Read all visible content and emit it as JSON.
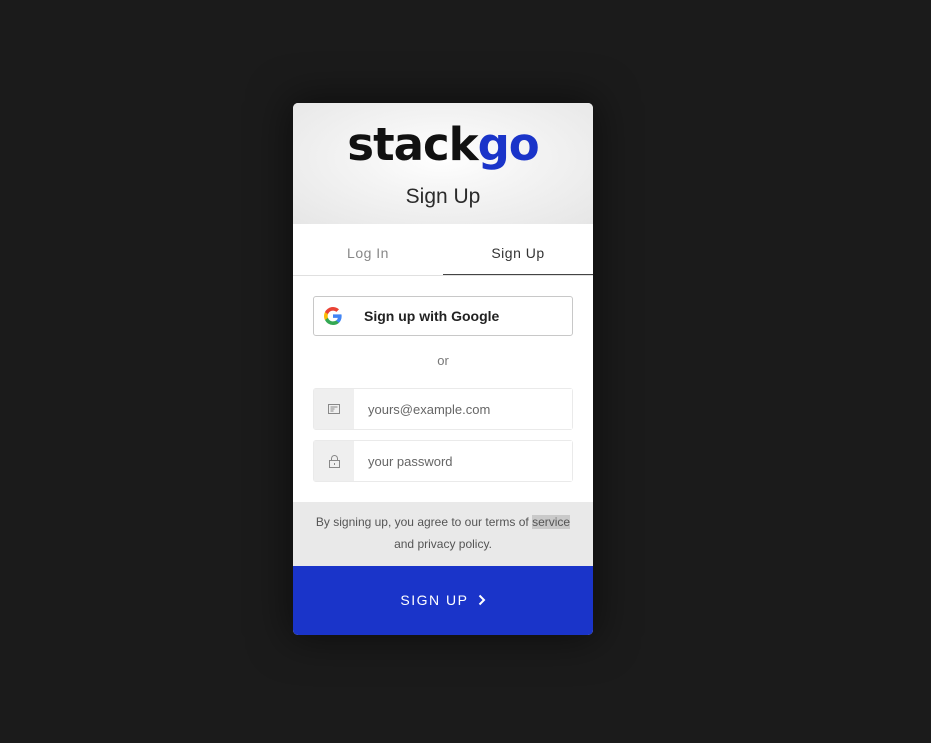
{
  "header": {
    "logo_part1": "stack",
    "logo_part2": "go",
    "title": "Sign Up"
  },
  "tabs": [
    {
      "label": "Log In",
      "active": false
    },
    {
      "label": "Sign Up",
      "active": true
    }
  ],
  "google_button": {
    "label": "Sign up with Google",
    "icon": "google-icon"
  },
  "divider": "or",
  "email": {
    "value": "",
    "placeholder": "yours@example.com",
    "icon": "envelope-icon"
  },
  "password": {
    "value": "",
    "placeholder": "your password",
    "icon": "lock-icon"
  },
  "terms": {
    "prefix": "By signing up, you agree to our",
    "terms_link": "terms of ",
    "terms_link_hl": "service",
    "conjunction": "and",
    "privacy_link": "privacy policy",
    "suffix": "."
  },
  "submit": {
    "label": "SIGN UP",
    "icon": "chevron-right-icon"
  },
  "colors": {
    "accent": "#1a34c9",
    "background": "#1b1b1b"
  }
}
